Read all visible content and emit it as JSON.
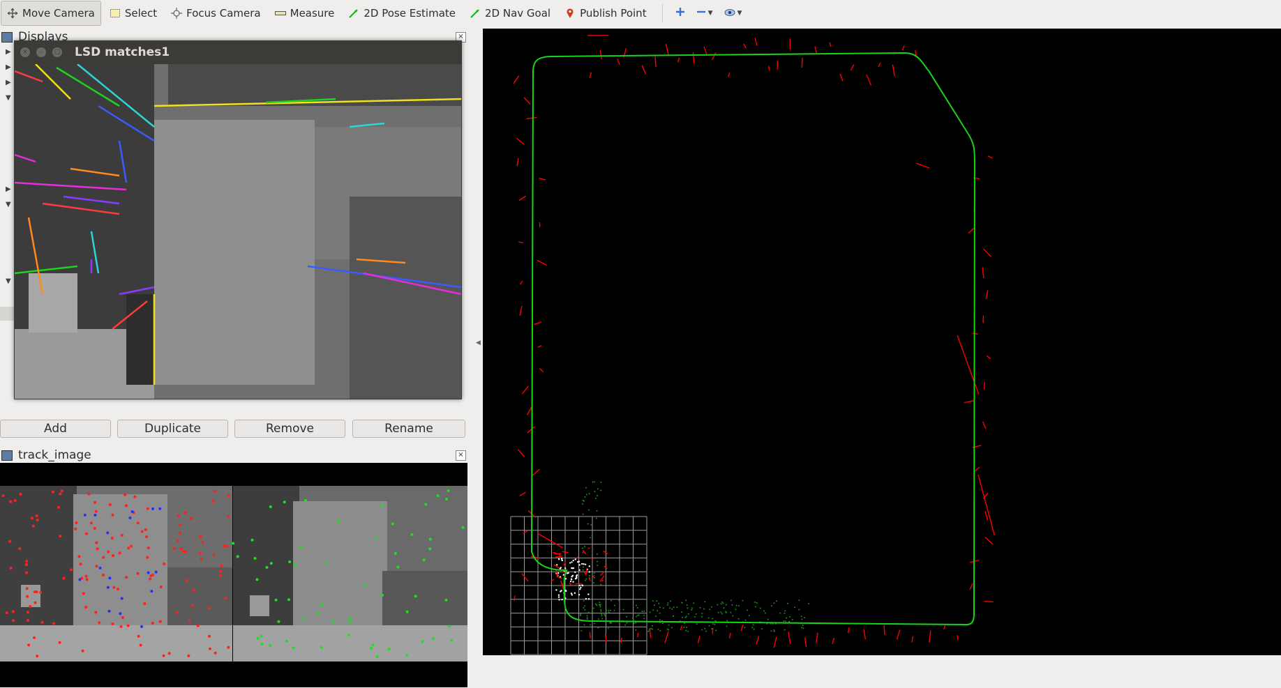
{
  "toolbar": {
    "tools": [
      {
        "label": "Move Camera",
        "icon": "move-camera-icon",
        "active": true
      },
      {
        "label": "Select",
        "icon": "select-icon",
        "active": false
      },
      {
        "label": "Focus Camera",
        "icon": "focus-camera-icon",
        "active": false
      },
      {
        "label": "Measure",
        "icon": "measure-icon",
        "active": false
      },
      {
        "label": "2D Pose Estimate",
        "icon": "pose-arrow-icon",
        "active": false
      },
      {
        "label": "2D Nav Goal",
        "icon": "nav-arrow-icon",
        "active": false
      },
      {
        "label": "Publish Point",
        "icon": "map-pin-icon",
        "active": false
      }
    ],
    "extra_icons": [
      "add-tool-icon",
      "remove-tool-icon",
      "camera-type-icon"
    ]
  },
  "displays_panel": {
    "title": "Displays",
    "buttons": [
      "Add",
      "Duplicate",
      "Remove",
      "Rename"
    ]
  },
  "floating_window": {
    "title": "LSD matches1"
  },
  "track_panel": {
    "title": "track_image"
  },
  "colors": {
    "trajectory": "#19d319",
    "landmarks": "#ff0000",
    "points_white": "#ffffff",
    "points_green": "#1b8f1b",
    "grid": "#9b9b9b",
    "viewport_bg": "#000000"
  }
}
